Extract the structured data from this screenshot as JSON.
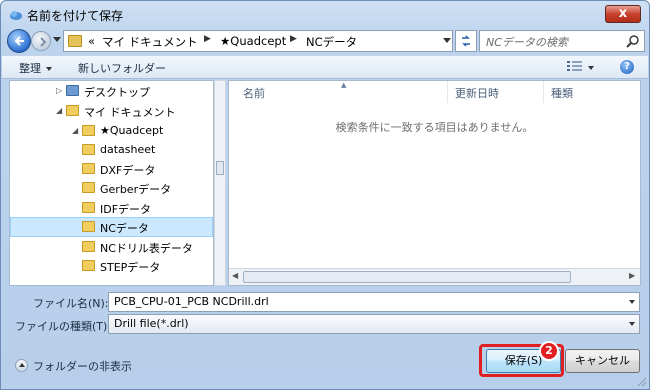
{
  "window": {
    "title": "名前を付けて保存",
    "close_glyph": "x"
  },
  "address": {
    "overflow": "«",
    "segments": [
      "マイ ドキュメント",
      "★Quadcept",
      "NCデータ"
    ],
    "search_placeholder": "NCデータの検索"
  },
  "toolbar": {
    "organize_label": "整理",
    "new_folder_label": "新しいフォルダー",
    "help_glyph": "?"
  },
  "tree": {
    "items": [
      {
        "label": "デスクトップ"
      },
      {
        "label": "マイ ドキュメント"
      },
      {
        "label": "★Quadcept"
      },
      {
        "label": "datasheet"
      },
      {
        "label": "DXFデータ"
      },
      {
        "label": "Gerberデータ"
      },
      {
        "label": "IDFデータ"
      },
      {
        "label": "NCデータ",
        "selected": true
      },
      {
        "label": "NCドリル表データ"
      },
      {
        "label": "STEPデータ"
      }
    ]
  },
  "file_list": {
    "columns": [
      "名前",
      "更新日時",
      "種類"
    ],
    "empty_message": "検索条件に一致する項目はありません。"
  },
  "form": {
    "filename_label": "ファイル名(N):",
    "filename_value": "PCB_CPU-01_PCB NCDrill.drl",
    "filetype_label": "ファイルの種類(T):",
    "filetype_value": "Drill file(*.drl)"
  },
  "footer": {
    "hide_folders_label": "フォルダーの非表示",
    "save_label": "保存(S)",
    "cancel_label": "キャンセル",
    "step_number": "2"
  },
  "colors": {
    "highlight": "#e02020",
    "selection": "#cce8ff"
  }
}
